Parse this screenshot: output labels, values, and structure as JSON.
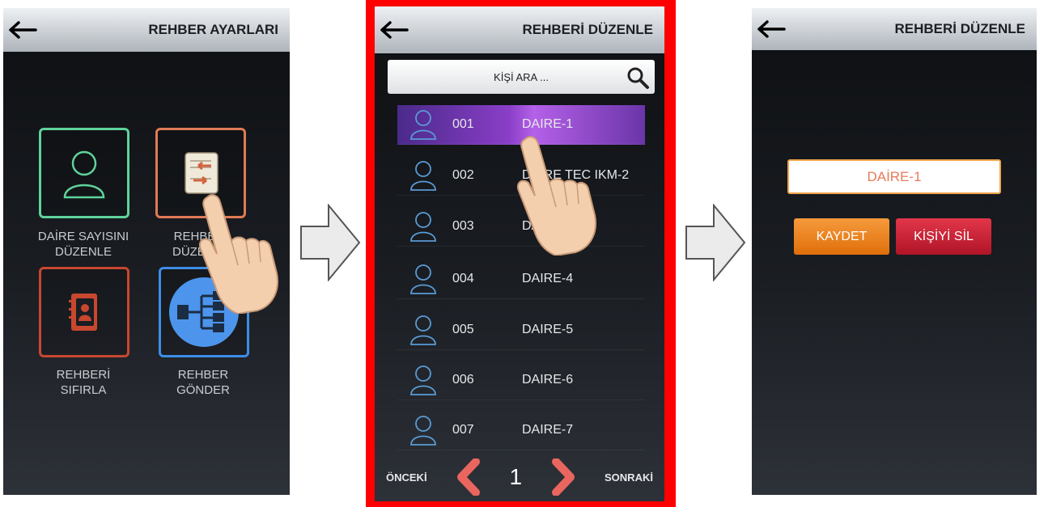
{
  "screen1": {
    "title": "REHBER AYARLARI",
    "tiles": [
      {
        "label_line1": "DAİRE SAYISINI",
        "label_line2": "DÜZENLE",
        "color": "#5fd39b",
        "icon": "person-icon"
      },
      {
        "label_line1": "REHBERİ",
        "label_line2": "DÜZENLE",
        "color": "#e07a55",
        "icon": "edit-contacts-icon"
      },
      {
        "label_line1": "REHBERİ",
        "label_line2": "SIFIRLA",
        "color": "#c8472f",
        "icon": "address-book-icon"
      },
      {
        "label_line1": "REHBER",
        "label_line2": "GÖNDER",
        "color": "#3d8de6",
        "icon": "share-network-icon"
      }
    ]
  },
  "screen2": {
    "title": "REHBERİ DÜZENLE",
    "search_placeholder": "KİŞİ ARA ...",
    "rows": [
      {
        "num": "001",
        "name": "DAIRE-1",
        "selected": true
      },
      {
        "num": "002",
        "name": "DAIRE TEC IKM-2",
        "selected": false
      },
      {
        "num": "003",
        "name": "DAIRE-3",
        "selected": false
      },
      {
        "num": "004",
        "name": "DAIRE-4",
        "selected": false
      },
      {
        "num": "005",
        "name": "DAIRE-5",
        "selected": false
      },
      {
        "num": "006",
        "name": "DAIRE-6",
        "selected": false
      },
      {
        "num": "007",
        "name": "DAIRE-7",
        "selected": false
      }
    ],
    "pager": {
      "prev": "ÖNCEKİ",
      "page": "1",
      "next": "SONRAKİ"
    },
    "highlight_color": "#ff0000"
  },
  "screen3": {
    "title": "REHBERİ DÜZENLE",
    "name_value": "DAİRE-1",
    "save_label": "KAYDET",
    "delete_label": "KİŞİYİ SİL",
    "save_color": "#f07d12",
    "delete_color": "#cc1f33"
  }
}
